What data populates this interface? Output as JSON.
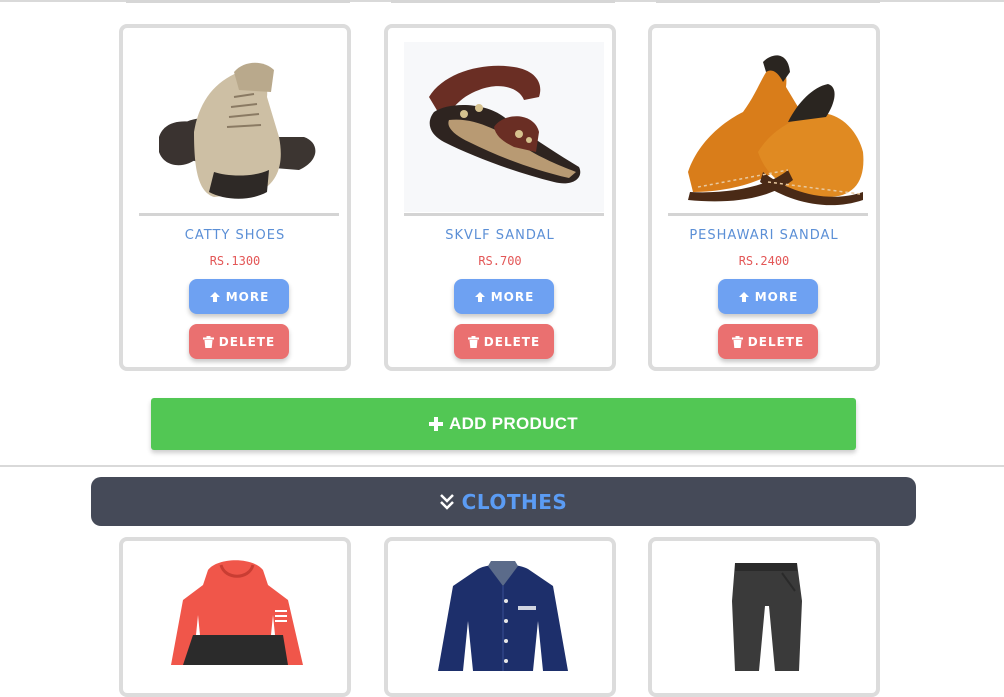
{
  "shoes": [
    {
      "name": "CATTY SHOES",
      "price": "RS.1300",
      "image": "hiking-shoe-image"
    },
    {
      "name": "SKVLF SANDAL",
      "price": "RS.700",
      "image": "sandal-image"
    },
    {
      "name": "PESHAWARI SANDAL",
      "price": "RS.2400",
      "image": "peshawari-sandal-image"
    }
  ],
  "buttons": {
    "more": "MORE",
    "delete": "DELETE",
    "add_product": "ADD PRODUCT"
  },
  "icons": {
    "more": "arrow-up-icon",
    "delete": "trash-icon",
    "add": "plus-icon",
    "category": "chevron-double-down-icon"
  },
  "category": {
    "label": "CLOTHES"
  },
  "clothes": [
    {
      "image": "hoodie-image"
    },
    {
      "image": "shirt-image"
    },
    {
      "image": "pants-image"
    }
  ],
  "colors": {
    "more": "#6ea1f2",
    "delete": "#ea7070",
    "add": "#52c754",
    "category_bar": "#454a58",
    "category_text": "#5b9cf4",
    "product_name": "#5b8fd6",
    "price": "#e35757"
  }
}
